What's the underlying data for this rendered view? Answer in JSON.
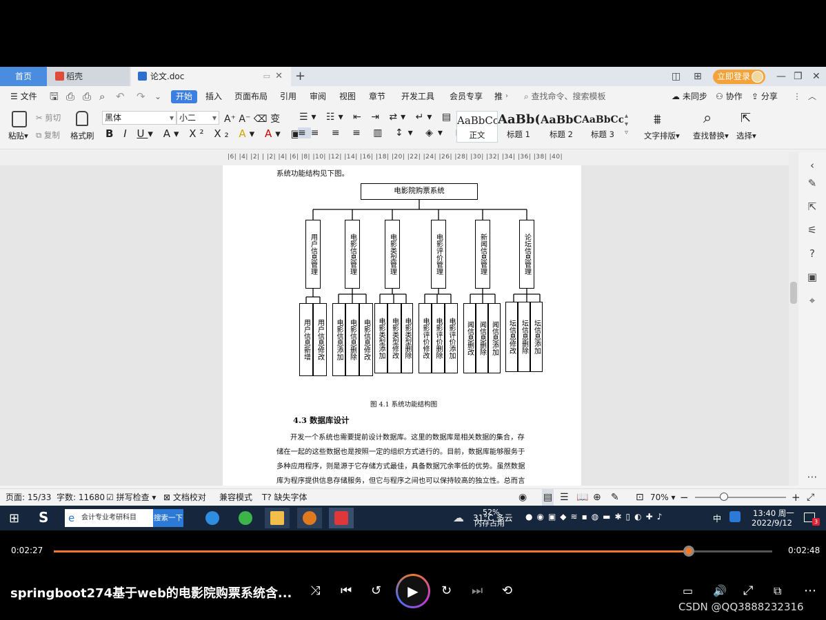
{
  "tabs": {
    "home": "首页",
    "daoke": "稻壳",
    "doc": "论文.doc"
  },
  "login": "立即登录",
  "menu": [
    "文件",
    "开始",
    "插入",
    "页面布局",
    "引用",
    "审阅",
    "视图",
    "章节",
    "开发工具",
    "会员专享",
    "推"
  ],
  "menu_search": "查找命令、搜索模板",
  "menu_right": {
    "sync": "未同步",
    "collab": "协作",
    "share": "分享"
  },
  "toolbar": {
    "paste": "粘贴",
    "cut": "剪切",
    "copy": "复制",
    "format_painter": "格式刷",
    "font": "黑体",
    "size": "小二",
    "styles": [
      {
        "sample": "AaBbCcI",
        "label": "正文"
      },
      {
        "sample": "AaBb(",
        "label": "标题 1"
      },
      {
        "sample": "AaBbC",
        "label": "标题 2"
      },
      {
        "sample": "AaBbCc",
        "label": "标题 3"
      }
    ],
    "text_layout": "文字排版",
    "find_replace": "查找替换",
    "select": "选择"
  },
  "ruler": "|6| |4| |2| | |2| |4| |6| |8| |10| |12| |14| |16| |18| |20| |22| |24| |26| |28| |30| |32| |34| |36| |38| |40|",
  "doc": {
    "intro": "系统功能结构见下图。",
    "diagram": {
      "root": "电影院购票系统",
      "modules": [
        {
          "name": "用户信息管理",
          "children": [
            "用户信息新增",
            "用户信息修改"
          ]
        },
        {
          "name": "电影信息管理",
          "children": [
            "电影信息添加",
            "电影信息删除",
            "电影信息修改"
          ]
        },
        {
          "name": "电影类型管理",
          "children": [
            "电影类型添加",
            "电影类型修改",
            "电影类型删除"
          ]
        },
        {
          "name": "电影评价管理",
          "children": [
            "电影评价修改",
            "电影评价删除",
            "电影评价添加"
          ]
        },
        {
          "name": "新闻信息管理",
          "children": [
            "闻信息删改",
            "闻信息删除",
            "闻信息添加"
          ]
        },
        {
          "name": "论坛信息管理",
          "children": [
            "坛信息修改",
            "坛信息删除",
            "坛信息添加"
          ]
        }
      ]
    },
    "caption": "图 4.1  系统功能结构图",
    "heading": "4.3  数据库设计",
    "para": [
      "开发一个系统也需要提前设计数据库。这里的数据库是相关数据的集合，存",
      "储在一起的这些数据也是按照一定的组织方式进行的。目前，数据库能够服务于",
      "多种应用程序，则是源于它存储方式最佳，具备数据冗余率低的优势。虽然数据",
      "库为程序提供信息存储服务，但它与程序之间也可以保持较高的独立性。总而言"
    ]
  },
  "status": {
    "page": "页面: 15/33",
    "words": "字数: 11680",
    "spell": "拼写检查",
    "proof": "文档校对",
    "compat": "兼容模式",
    "font_missing": "缺失字体",
    "zoom": "70%"
  },
  "taskbar": {
    "search_text": "会计专业考研科目",
    "search_btn": "搜索一下",
    "weather": "31°C 多云",
    "mem": "52%",
    "mem_label": "内存占用",
    "ime": "中",
    "time": "13:40 周一",
    "date": "2022/9/12",
    "badge": "3"
  },
  "player": {
    "elapsed": "0:02:27",
    "total": "0:02:48",
    "progress": 0.884,
    "title": "springboot274基于web的电影院购票系统含...",
    "watermark": "CSDN @QQ3888232316"
  }
}
